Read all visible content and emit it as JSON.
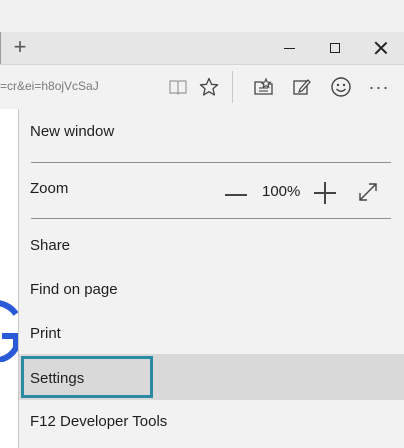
{
  "window": {
    "url_fragment": "=cr&ei=h8ojVcSaJ",
    "new_tab_symbol": "+",
    "controls": [
      "minimize",
      "maximize",
      "close"
    ]
  },
  "toolbar": {
    "icons": [
      "reading-view-icon",
      "favorite-star-icon",
      "hub-icon",
      "web-note-icon",
      "feedback-smiley-icon",
      "more-actions-icon"
    ],
    "more_label": "···"
  },
  "menu": {
    "new_window": "New window",
    "zoom_label": "Zoom",
    "zoom_value": "100%",
    "share": "Share",
    "find_on_page": "Find on page",
    "print": "Print",
    "settings": "Settings",
    "f12_tools": "F12 Developer Tools"
  },
  "colors": {
    "menu_bg": "#f2f2f2",
    "highlight_bg": "#d9d9d9",
    "focus_border": "#2a8aa3",
    "google_blue": "#2a5ad7"
  }
}
